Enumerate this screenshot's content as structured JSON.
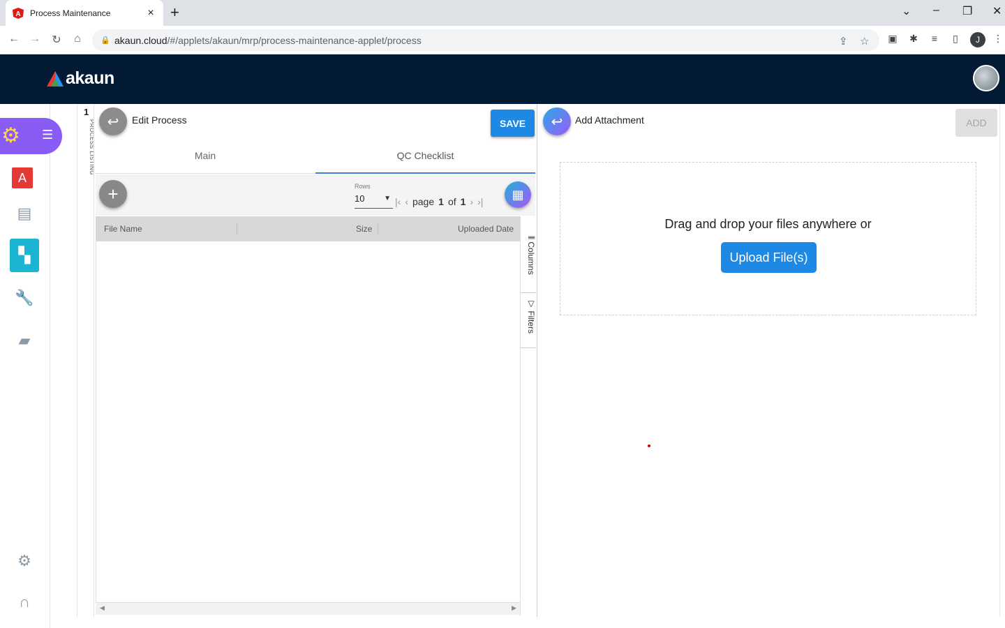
{
  "browser": {
    "tab_title": "Process Maintenance",
    "tab_close": "×",
    "new_tab": "+",
    "url_host": "akaun.cloud",
    "url_path": "/#/applets/akaun/mrp/process-maintenance-applet/process",
    "profile_initial": "J",
    "window_controls": [
      "⌄",
      "–",
      "❐",
      "✕"
    ]
  },
  "app": {
    "logo_text": "akaun",
    "brand_colors": {
      "header": "#021a33",
      "accent": "#1e88e5",
      "rail_active": "#1bb4d2",
      "chip": "#8a5cf6"
    }
  },
  "rail": {
    "items": [
      {
        "icon": "pdf-icon",
        "glyph": "⬛"
      },
      {
        "icon": "document-icon",
        "glyph": "▤"
      },
      {
        "icon": "hierarchy-icon",
        "glyph": "▚",
        "active": true
      },
      {
        "icon": "wrench-icon",
        "glyph": "🔧"
      },
      {
        "icon": "briefcase-icon",
        "glyph": "▰"
      },
      {
        "icon": "settings-icon",
        "glyph": "⚙"
      },
      {
        "icon": "headset-icon",
        "glyph": "∩"
      }
    ]
  },
  "listing_strip": {
    "count": "1",
    "label": "PROCESS LISTING"
  },
  "edit_process": {
    "title": "Edit Process",
    "save_label": "SAVE",
    "tabs": [
      "Main",
      "QC Checklist"
    ],
    "active_tab": "QC Checklist",
    "grid": {
      "rows_label": "Rows",
      "rows_value": "10",
      "page_word": "page",
      "page_current": "1",
      "of_word": "of",
      "page_total": "1",
      "columns": [
        "File Name",
        "Size",
        "Uploaded Date"
      ],
      "side_buttons": [
        "Columns",
        "Filters"
      ]
    }
  },
  "attachment": {
    "title": "Add Attachment",
    "add_label": "ADD",
    "drop_text": "Drag and drop your files anywhere or",
    "upload_label": "Upload File(s)"
  }
}
